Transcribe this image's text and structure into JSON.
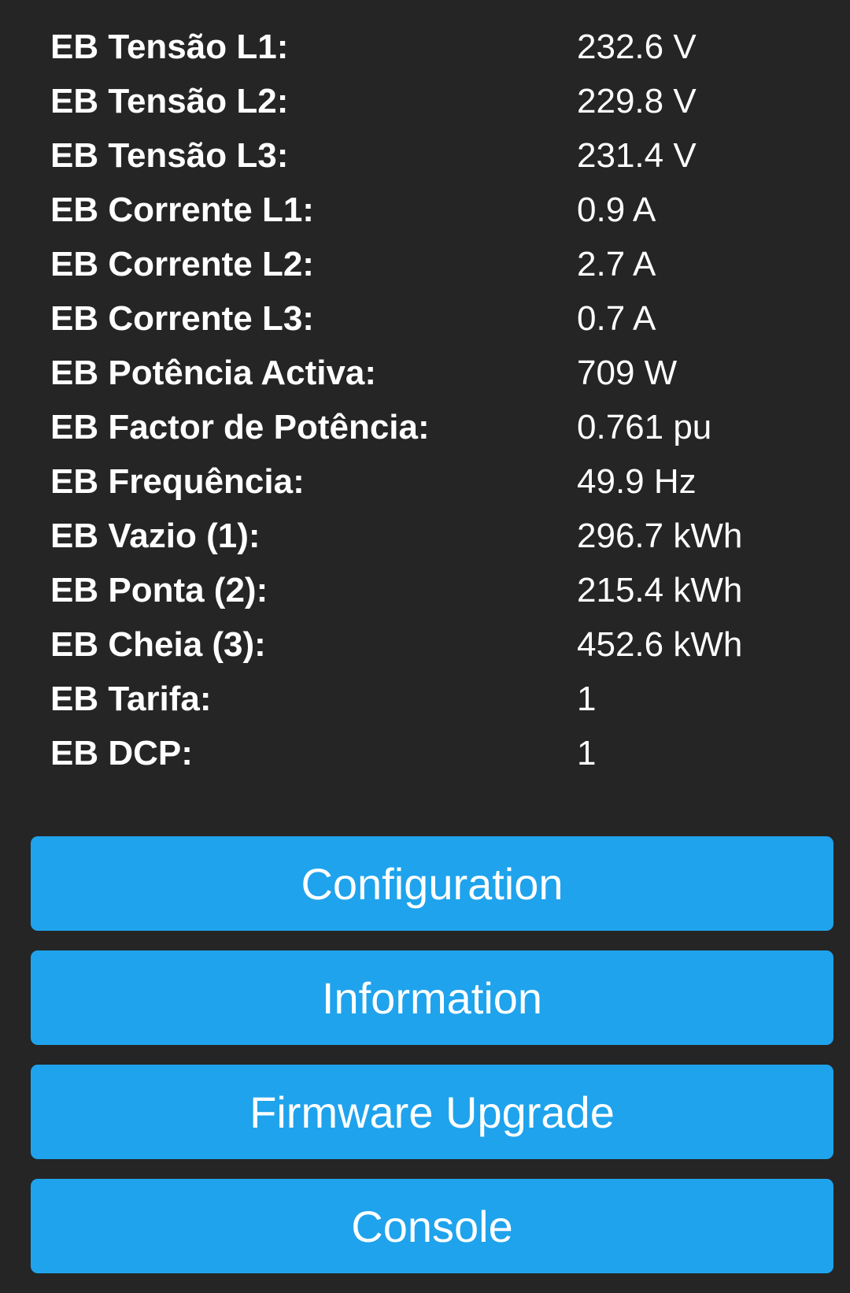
{
  "readings": [
    {
      "label": "EB Tensão L1:",
      "value": "232.6 V"
    },
    {
      "label": "EB Tensão L2:",
      "value": "229.8 V"
    },
    {
      "label": "EB Tensão L3:",
      "value": "231.4 V"
    },
    {
      "label": "EB Corrente L1:",
      "value": "0.9 A"
    },
    {
      "label": "EB Corrente L2:",
      "value": "2.7 A"
    },
    {
      "label": "EB Corrente L3:",
      "value": "0.7 A"
    },
    {
      "label": "EB Potência Activa:",
      "value": "709 W"
    },
    {
      "label": "EB Factor de Potência:",
      "value": "0.761 pu"
    },
    {
      "label": "EB Frequência:",
      "value": "49.9 Hz"
    },
    {
      "label": "EB Vazio (1):",
      "value": "296.7 kWh"
    },
    {
      "label": "EB Ponta (2):",
      "value": "215.4 kWh"
    },
    {
      "label": "EB Cheia (3):",
      "value": "452.6 kWh"
    },
    {
      "label": "EB Tarifa:",
      "value": "1"
    },
    {
      "label": "EB DCP:",
      "value": "1"
    }
  ],
  "buttons": {
    "configuration": "Configuration",
    "information": "Information",
    "firmware_upgrade": "Firmware Upgrade",
    "console": "Console"
  },
  "colors": {
    "background": "#252525",
    "button": "#1fa3ec",
    "text": "#ffffff"
  }
}
